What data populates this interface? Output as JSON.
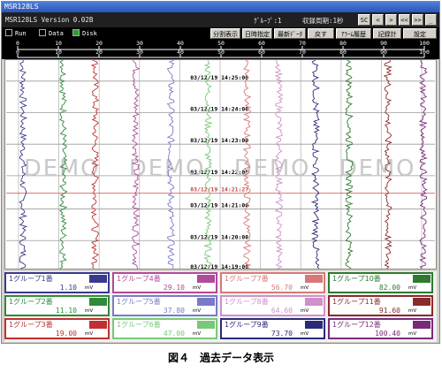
{
  "window": {
    "title": "MSR128LS"
  },
  "appbar": {
    "version": "MSR128LS Version 0.02B",
    "group": "ｸﾞﾙｰﾌﾟ:1",
    "cycle": "収録周期:1秒",
    "nav": [
      "SC",
      "<",
      ">",
      "<<",
      ">>",
      "_"
    ]
  },
  "status": {
    "run": "Run",
    "data": "Data",
    "disk": "Disk"
  },
  "toolbar": [
    "分割表示",
    "日時指定",
    "最新ﾃﾞｰﾀ",
    "戻す",
    "ｱﾗｰﾑ履歴",
    "記録計",
    "設定"
  ],
  "scale": {
    "top_ticks": [
      "0",
      "10",
      "20",
      "30",
      "40",
      "50",
      "60",
      "70",
      "80",
      "90",
      "100"
    ],
    "bottom_ticks": [
      "0",
      "10",
      "20",
      "30",
      "40",
      "50",
      "60",
      "70",
      "80",
      "90",
      "100"
    ]
  },
  "timestamps": [
    "03/12/19 14:25:00",
    "03/12/19 14:24:00",
    "03/12/19 14:23:00",
    "03/12/19 14:22:00",
    "03/12/19 14:21:27",
    "03/12/19 14:21:00",
    "03/12/19 14:20:00",
    "03/12/19 14:19:00"
  ],
  "watermark": [
    "DEMO",
    "DEMO",
    "DEMO",
    "DEMO"
  ],
  "channels": [
    {
      "name": "1グループ1番",
      "value": "1.10",
      "unit": "mV",
      "color": "#3a3a8c"
    },
    {
      "name": "1グループ2番",
      "value": "11.10",
      "unit": "mV",
      "color": "#2e8b3a"
    },
    {
      "name": "1グループ3番",
      "value": "19.00",
      "unit": "mV",
      "color": "#c03030"
    },
    {
      "name": "1グループ4番",
      "value": "29.10",
      "unit": "mV",
      "color": "#b04a9a"
    },
    {
      "name": "1グループ5番",
      "value": "37.80",
      "unit": "mV",
      "color": "#7a7ac8"
    },
    {
      "name": "1グループ6番",
      "value": "47.00",
      "unit": "mV",
      "color": "#78c878"
    },
    {
      "name": "1グループ7番",
      "value": "56.70",
      "unit": "mV",
      "color": "#d87878"
    },
    {
      "name": "1グループ8番",
      "value": "64.60",
      "unit": "mV",
      "color": "#d090c8"
    },
    {
      "name": "1グループ9番",
      "value": "73.70",
      "unit": "mV",
      "color": "#2a2a7a"
    },
    {
      "name": "1グループ10番",
      "value": "82.00",
      "unit": "mV",
      "color": "#2e7a2e"
    },
    {
      "name": "1グループ11番",
      "value": "91.60",
      "unit": "mV",
      "color": "#8a2a2a"
    },
    {
      "name": "1グループ12番",
      "value": "100.40",
      "unit": "mV",
      "color": "#7a2a7a"
    }
  ],
  "caption": "図４　過去データ表示"
}
